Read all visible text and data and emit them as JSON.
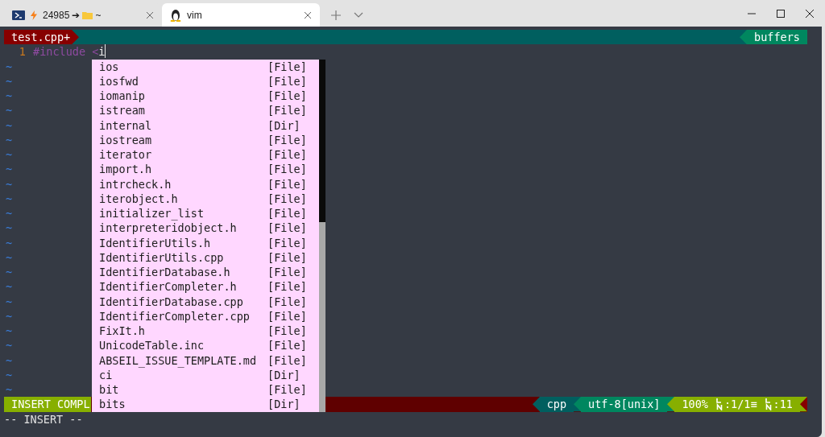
{
  "window": {
    "tabs": [
      {
        "kind": "shell",
        "parts": [
          "24985",
          "➔",
          "~"
        ],
        "selected": false
      },
      {
        "kind": "linux",
        "parts": [
          "vim"
        ],
        "selected": true
      }
    ]
  },
  "vim": {
    "tabline": {
      "buffer": "test.cpp+",
      "right": "buffers"
    },
    "lines": [
      {
        "number": "1",
        "keyword": "#include <",
        "text": "i"
      }
    ],
    "filler": [
      "~",
      "~",
      "~",
      "~",
      "~",
      "~",
      "~",
      "~",
      "~",
      "~",
      "~",
      "~",
      "~",
      "~",
      "~",
      "~",
      "~",
      "~",
      "~",
      "~",
      "~",
      "~",
      "~"
    ],
    "popup": [
      {
        "word": "ios",
        "kind": "[File]",
        "selected": false
      },
      {
        "word": "iosfwd",
        "kind": "[File]",
        "selected": false
      },
      {
        "word": "iomanip",
        "kind": "[File]",
        "selected": false
      },
      {
        "word": "istream",
        "kind": "[File]",
        "selected": false
      },
      {
        "word": "internal",
        "kind": "[Dir]",
        "selected": false
      },
      {
        "word": "iostream",
        "kind": "[File]",
        "selected": false
      },
      {
        "word": "iterator",
        "kind": "[File]",
        "selected": false
      },
      {
        "word": "import.h",
        "kind": "[File]",
        "selected": false
      },
      {
        "word": "intrcheck.h",
        "kind": "[File]",
        "selected": false
      },
      {
        "word": "iterobject.h",
        "kind": "[File]",
        "selected": false
      },
      {
        "word": "initializer_list",
        "kind": "[File]",
        "selected": false
      },
      {
        "word": "interpreteridobject.h",
        "kind": "[File]",
        "selected": false
      },
      {
        "word": "IdentifierUtils.h",
        "kind": "[File]",
        "selected": false
      },
      {
        "word": "IdentifierUtils.cpp",
        "kind": "[File]",
        "selected": false
      },
      {
        "word": "IdentifierDatabase.h",
        "kind": "[File]",
        "selected": false
      },
      {
        "word": "IdentifierCompleter.h",
        "kind": "[File]",
        "selected": false
      },
      {
        "word": "IdentifierDatabase.cpp",
        "kind": "[File]",
        "selected": false
      },
      {
        "word": "IdentifierCompleter.cpp",
        "kind": "[File]",
        "selected": false
      },
      {
        "word": "FixIt.h",
        "kind": "[File]",
        "selected": false
      },
      {
        "word": "UnicodeTable.inc",
        "kind": "[File]",
        "selected": false
      },
      {
        "word": "ABSEIL_ISSUE_TEMPLATE.md",
        "kind": "[File]",
        "selected": false
      },
      {
        "word": "ci",
        "kind": "[Dir]",
        "selected": false
      },
      {
        "word": "bit",
        "kind": "[File]",
        "selected": false
      },
      {
        "word": "bits",
        "kind": "[Dir]",
        "selected": false
      }
    ],
    "statusline": {
      "mode": "INSERT COMPL",
      "filetype": "cpp",
      "encoding": "utf-8[unix]",
      "percent": "100%",
      "line": ":1/1≡",
      "column": ":11"
    },
    "cmdline": "-- INSERT --"
  }
}
